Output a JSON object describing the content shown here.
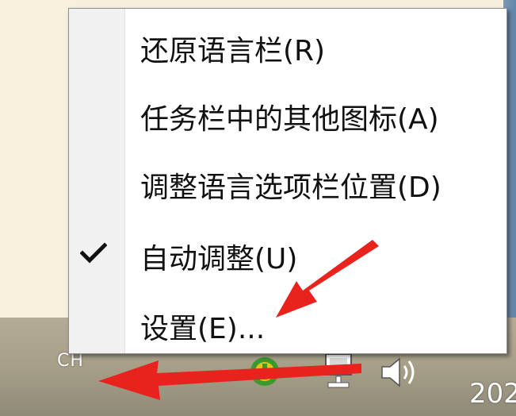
{
  "menu": {
    "items": [
      {
        "label": "还原语言栏(R)",
        "checked": false
      },
      {
        "label": "任务栏中的其他图标(A)",
        "checked": false
      },
      {
        "label": "调整语言选项栏位置(D)",
        "checked": false
      },
      {
        "label": "自动调整(U)",
        "checked": true
      },
      {
        "label": "设置(E)...",
        "checked": false
      }
    ]
  },
  "taskbar": {
    "language_indicator": "CH",
    "clock_fragment": "202",
    "tray_icons": [
      "security-shield-icon",
      "network-icon",
      "volume-icon"
    ]
  },
  "annotations": {
    "arrow_color": "#e8231e",
    "arrows": [
      "arrow-to-settings",
      "arrow-to-language-indicator"
    ]
  },
  "colors": {
    "desktop_bg": "#f8f0dd",
    "menu_bg": "#ffffff",
    "menu_gutter": "#f1f1f1",
    "taskbar": "#a59d86"
  }
}
